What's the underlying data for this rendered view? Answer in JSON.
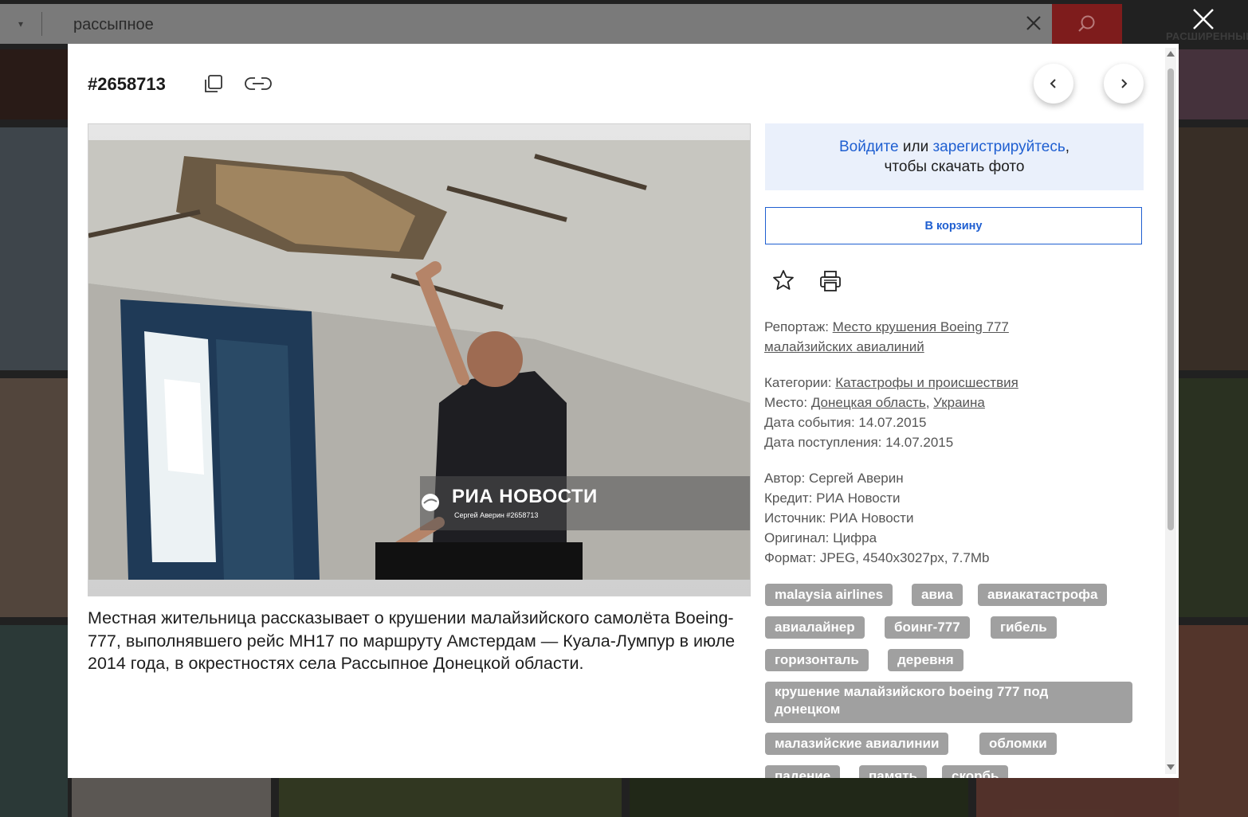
{
  "search": {
    "value": "рассыпное",
    "dropdown_glyph": "▾",
    "advanced_label": "РАСШИРЕННЫЙ"
  },
  "icons": {
    "clear": "close-icon",
    "search": "search-icon",
    "close_modal": "close-icon",
    "copy": "copy-icon",
    "link": "link-icon",
    "prev": "chevron-left-icon",
    "next": "chevron-right-icon",
    "favorite": "star-icon",
    "print": "printer-icon"
  },
  "colors": {
    "accent_blue": "#1f5fd1",
    "search_button": "#7e1c1c",
    "login_bg": "#eaf0fb",
    "tag_bg": "#a0a0a0"
  },
  "modal": {
    "photo_id": "#2658713",
    "watermark": {
      "brand": "РИА НОВОСТИ",
      "credit": "Сергей Аверин #2658713"
    },
    "caption": "Местная жительница рассказывает о крушении малайзийского самолёта Boeing-777, выполнявшего рейс МН17 по маршруту Амстердам — Куала-Лумпур в июле 2014 года, в окрестностях села Рассыпное Донецкой области.",
    "login": {
      "signin": "Войдите",
      "or": " или ",
      "register": "зарегистрируйтесь",
      "comma": ",",
      "line2": "чтобы скачать фото"
    },
    "cart_button": "В корзину",
    "report": {
      "label": "Репортаж: ",
      "line1": "Место крушения Boeing 777",
      "line2": "малайзийских авиалиний"
    },
    "categories": {
      "label": "Категории: ",
      "value": "Катастрофы и происшествия"
    },
    "place": {
      "label": "Место: ",
      "region": "Донецкая область",
      "sep": ", ",
      "country": "Украина"
    },
    "event_date": "Дата события: 14.07.2015",
    "received_date": "Дата поступления: 14.07.2015",
    "author": "Автор: Сергей Аверин",
    "credit": "Кредит: РИА Новости",
    "source": "Источник: РИА Новости",
    "original": "Оригинал: Цифра",
    "format": "Формат: JPEG, 4540x3027px, 7.7Mb",
    "tags": [
      "malaysia airlines",
      "авиа",
      "авиакатастрофа",
      "авиалайнер",
      "боинг-777",
      "гибель",
      "горизонталь",
      "деревня",
      "крушение малайзийского boeing 777 под",
      "донецком",
      "малазийские авиалинии",
      "обломки",
      "падение",
      "память",
      "скорбь"
    ]
  }
}
